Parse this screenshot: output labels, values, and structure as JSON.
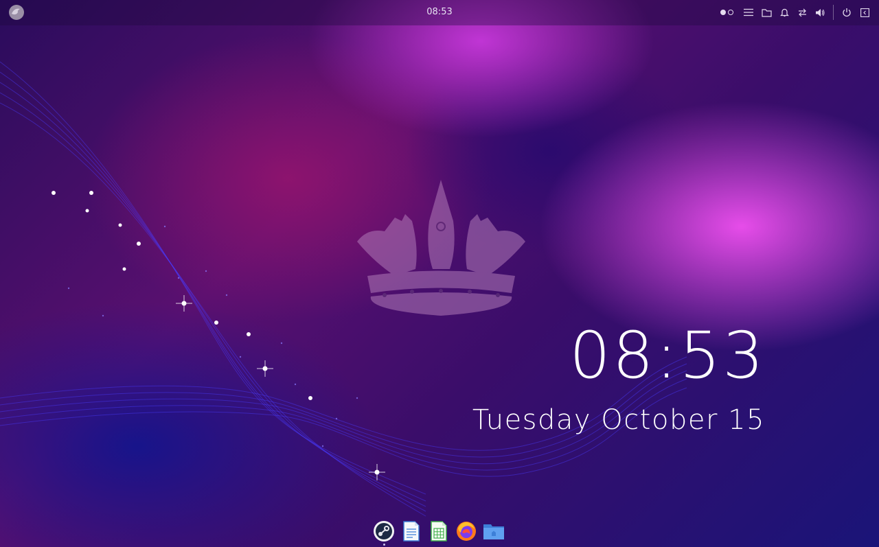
{
  "topbar": {
    "logo_icon": "budgie-bird-icon",
    "clock": "08:53",
    "workspaces": 2,
    "active_workspace": 1,
    "tray_icons": [
      "menu-icon",
      "folder-icon",
      "notification-bell-icon",
      "network-transfer-icon",
      "volume-icon",
      "power-icon",
      "sidebar-toggle-icon"
    ]
  },
  "desktop": {
    "clock": "08:53",
    "date": "Tuesday October 15",
    "accent": "#e040f0"
  },
  "dock": {
    "apps": [
      {
        "name": "steam-icon",
        "running": true
      },
      {
        "name": "writer-document-icon",
        "running": false
      },
      {
        "name": "calc-spreadsheet-icon",
        "running": false
      },
      {
        "name": "firefox-icon",
        "running": false
      },
      {
        "name": "files-folder-icon",
        "running": false
      }
    ]
  }
}
